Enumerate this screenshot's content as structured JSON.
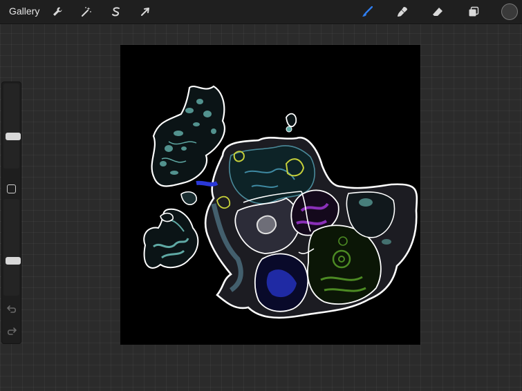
{
  "toolbar": {
    "gallery_label": "Gallery",
    "left_tools": [
      {
        "name": "actions",
        "icon": "wrench-icon"
      },
      {
        "name": "adjustments",
        "icon": "magic-wand-icon"
      },
      {
        "name": "selection",
        "icon": "selection-s-icon"
      },
      {
        "name": "transform",
        "icon": "arrow-cursor-icon"
      }
    ],
    "right_tools": [
      {
        "name": "brush",
        "icon": "brush-icon",
        "active": true
      },
      {
        "name": "smudge",
        "icon": "smudge-icon"
      },
      {
        "name": "eraser",
        "icon": "eraser-icon"
      },
      {
        "name": "layers",
        "icon": "layers-icon"
      }
    ],
    "color_swatch": "#3a3a3a"
  },
  "sidebar": {
    "brush_size_level": 0.37,
    "opacity_level": 0.35,
    "controls": [
      "modify-button",
      "undo-icon",
      "redo-icon"
    ]
  },
  "canvas": {
    "background": "#000000",
    "palette": {
      "outline": "#ffffff",
      "teal": "#5fa9a4",
      "blue": "#2a38d8",
      "purple": "#8a2fb8",
      "green": "#4c8a23",
      "yellow": "#c7d13a",
      "slate": "#4a6b7a",
      "gray": "#3a3a44"
    }
  }
}
